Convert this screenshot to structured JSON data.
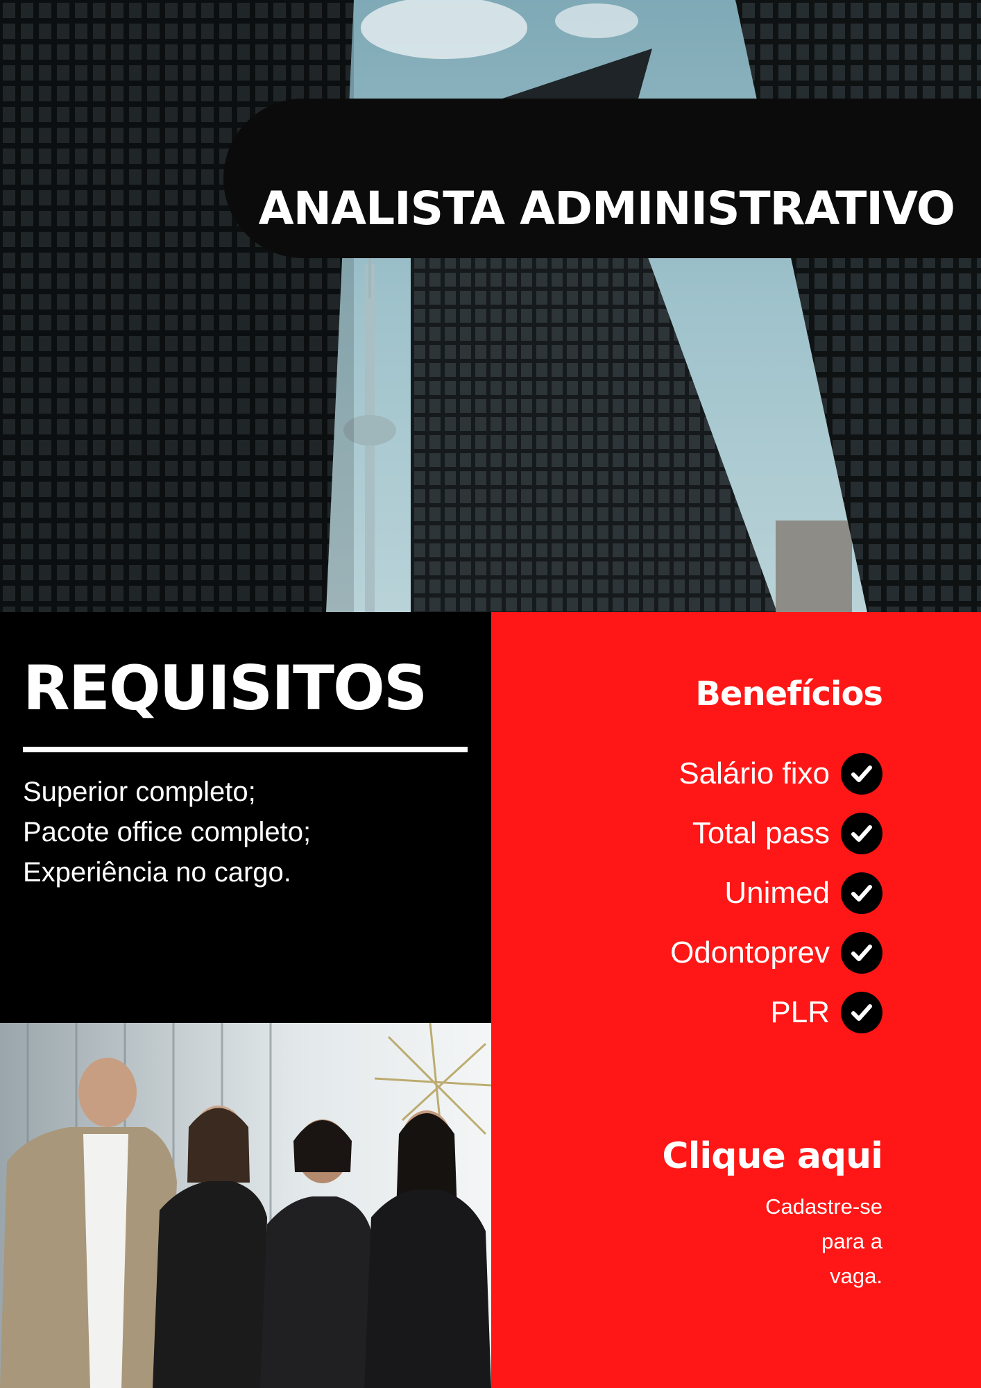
{
  "header": {
    "title": "ANALISTA ADMINISTRATIVO"
  },
  "requirements": {
    "title": "REQUISITOS",
    "items": [
      "Superior completo;",
      "Pacote office completo;",
      "Experiência no cargo."
    ]
  },
  "benefits": {
    "title": "Benefícios",
    "items": [
      {
        "label": "Salário fixo"
      },
      {
        "label": "Total pass"
      },
      {
        "label": "Unimed"
      },
      {
        "label": "Odontoprev"
      },
      {
        "label": "PLR"
      }
    ],
    "check_icon": "check-circle-icon"
  },
  "cta": {
    "title": "Clique aqui",
    "lines": [
      "Cadastre-se",
      "para a",
      "vaga."
    ]
  },
  "colors": {
    "accent_red": "#fe1716",
    "panel_black": "#000000",
    "text_white": "#ffffff"
  },
  "images": {
    "hero": "city-skyscrapers-photo",
    "team": "business-team-photo"
  }
}
